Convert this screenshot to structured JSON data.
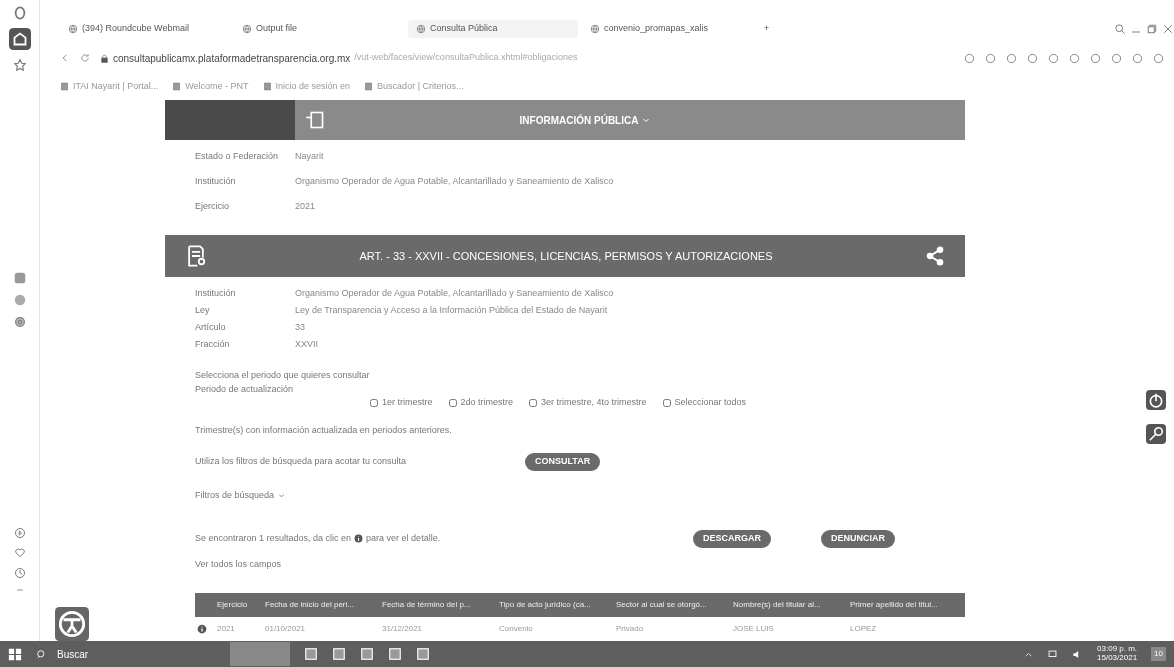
{
  "browser": {
    "tabs": [
      {
        "label": "(394) Roundcube Webmail",
        "selected": false
      },
      {
        "label": "Output file",
        "selected": false
      },
      {
        "label": "Consulta Pública",
        "selected": true
      },
      {
        "label": "convenio_promapas_xalis",
        "selected": false
      }
    ],
    "new_tab": "+",
    "url": {
      "host": "consultapublicamx.plataformadetransparencia.org.mx",
      "path": "/vut-web/faces/view/consultaPublica.xhtml#obligaciones"
    },
    "bookmarks": [
      "ITAI Nayarit | Portal...",
      "Welcome - PNT",
      "Inicio de sesión en",
      "Buscador | Criterios..."
    ]
  },
  "page": {
    "menu": "INFORMACIÓN PÚBLICA",
    "form": [
      {
        "label": "Estado o Federación",
        "value": "Nayarit"
      },
      {
        "label": "Institución",
        "value": "Organismo Operador de Agua Potable, Alcantarillado y Saneamiento de Xalisco"
      },
      {
        "label": "Ejercicio",
        "value": "2021"
      }
    ],
    "section_title": "ART. - 33 - XXVII - CONCESIONES, LICENCIAS, PERMISOS Y AUTORIZACIONES",
    "details": [
      {
        "label": "Institución",
        "value": "Organismo Operador de Agua Potable, Alcantarillado y Saneamiento de Xalisco"
      },
      {
        "label": "Ley",
        "value": "Ley de Transparencia y Acceso a la Información Pública del Estado de Nayarit"
      },
      {
        "label": "Artículo",
        "value": "33"
      },
      {
        "label": "Fracción",
        "value": "XXVII"
      }
    ],
    "period_prompt": "Selecciona el periodo que quieres consultar",
    "period_label": "Periodo de actualización",
    "periods": [
      {
        "label": "1er trimestre",
        "checked": false
      },
      {
        "label": "2do trimestre",
        "checked": false
      },
      {
        "label": "3er trimestre, 4to trimestre",
        "checked": false
      },
      {
        "label": "Seleccionar todos",
        "checked": false
      }
    ],
    "note": "Trimestre(s) con información actualizada en periodos anteriores.",
    "filter_hint": "Utiliza los filtros de búsqueda para acotar tu consulta",
    "consult_button": "CONSULTAR",
    "filters_toggle": "Filtros de búsqueda",
    "results_before": "Se encontraron 1 resultados, da clic en",
    "results_after": "para ver el detalle.",
    "actions": [
      "DESCARGAR",
      "DENUNCIAR"
    ],
    "show_all": "Ver todos los campos",
    "table": {
      "columns": [
        "Ejercicio",
        "Fecha de inicio del peri...",
        "Fecha de término del p...",
        "Tipo de acto jurídico (ca...",
        "Sector al cual se otorgó...",
        "Nombre(s) del titular al...",
        "Primer apellido del titul..."
      ],
      "rows": [
        [
          "2021",
          "01/10/2021",
          "31/12/2021",
          "Convenio",
          "Privado",
          "JOSE LUIS",
          "LOPEZ"
        ]
      ]
    }
  },
  "taskbar": {
    "search_placeholder": "Buscar",
    "time": "03:09 p. m.",
    "date": "15/03/2021",
    "notifications": "10"
  }
}
